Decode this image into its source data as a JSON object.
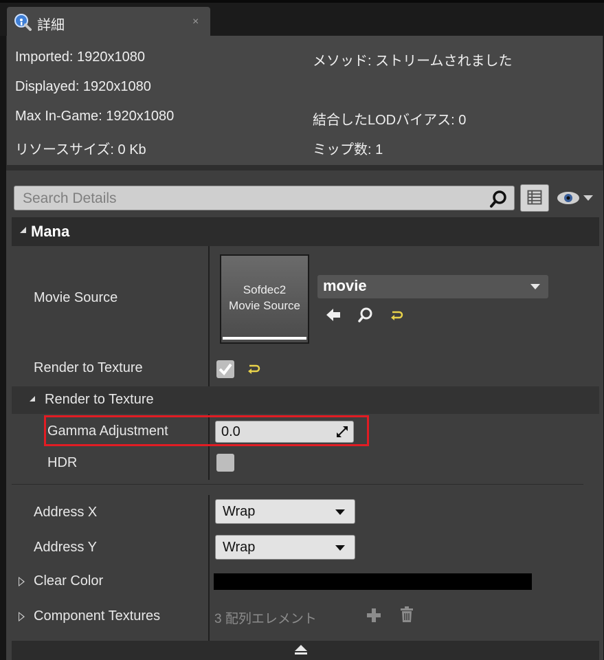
{
  "tab": {
    "title": "詳細",
    "close": "×"
  },
  "stats": {
    "imported": "Imported: 1920x1080",
    "displayed": "Displayed: 1920x1080",
    "max_ingame": "Max In-Game: 1920x1080",
    "resource_size": "リソースサイズ: 0 Kb",
    "method": "メソッド: ストリームされました",
    "lod_bias": "結合したLODバイアス: 0",
    "mip_count": "ミップ数: 1"
  },
  "search": {
    "placeholder": "Search Details"
  },
  "category": {
    "label": "Mana"
  },
  "properties": {
    "movie_source": {
      "label": "Movie Source",
      "thumbnail_text_line1": "Sofdec2",
      "thumbnail_text_line2": "Movie Source",
      "value": "movie"
    },
    "render_to_texture": {
      "label": "Render to Texture",
      "checked": true
    },
    "render_to_texture_group": {
      "label": "Render to Texture"
    },
    "gamma_adjustment": {
      "label": "Gamma Adjustment",
      "value": "0.0"
    },
    "hdr": {
      "label": "HDR",
      "checked": false
    },
    "address_x": {
      "label": "Address X",
      "value": "Wrap"
    },
    "address_y": {
      "label": "Address Y",
      "value": "Wrap"
    },
    "clear_color": {
      "label": "Clear Color",
      "color": "#000000"
    },
    "component_textures": {
      "label": "Component Textures",
      "summary": "3 配列エレメント"
    }
  },
  "colors": {
    "highlight": "#e21c23",
    "reset_arrow": "#e8d24a"
  },
  "icons": [
    "details-magnifier-icon",
    "tab-close-icon",
    "search-icon",
    "property-matrix-icon",
    "eye-icon",
    "browse-back-arrow-icon",
    "find-in-browser-icon",
    "reset-to-default-icon",
    "checkmark-icon",
    "expand-value-icon",
    "add-element-icon",
    "trash-icon",
    "eject-icon"
  ]
}
